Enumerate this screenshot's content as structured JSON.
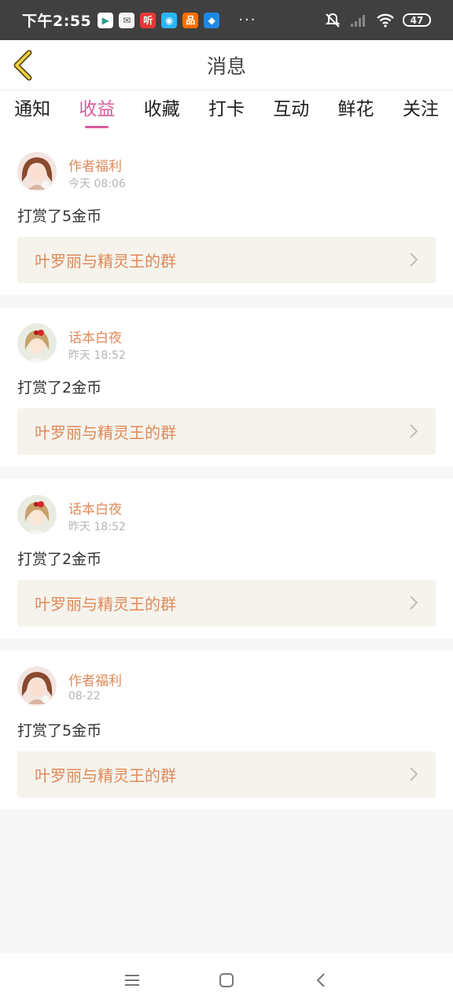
{
  "status_bar": {
    "time": "下午2:55",
    "app_icons": [
      {
        "name": "play-store-icon",
        "color": "#2a9d8f",
        "glyph": "▶"
      },
      {
        "name": "mi-app-icon",
        "color": "#f5f5f5",
        "glyph": "✉"
      },
      {
        "name": "listen-app-icon",
        "color": "#e53935",
        "glyph": "听"
      },
      {
        "name": "weibo-app-icon",
        "color": "#29b6f6",
        "glyph": "◉"
      },
      {
        "name": "shopping-app-icon",
        "color": "#ff6f00",
        "glyph": "品"
      },
      {
        "name": "blue-app-icon",
        "color": "#1e88e5",
        "glyph": "◆"
      }
    ],
    "dots": "···",
    "battery": "47"
  },
  "header": {
    "title": "消息"
  },
  "tabs": [
    {
      "label": "通知",
      "active": false
    },
    {
      "label": "收益",
      "active": true
    },
    {
      "label": "收藏",
      "active": false
    },
    {
      "label": "打卡",
      "active": false
    },
    {
      "label": "互动",
      "active": false
    },
    {
      "label": "鲜花",
      "active": false
    },
    {
      "label": "关注",
      "active": false
    }
  ],
  "messages": [
    {
      "name": "作者福利",
      "time": "今天 08:06",
      "text": "打赏了5金币",
      "link": "叶罗丽与精灵王的群",
      "avatar": "girl-brown"
    },
    {
      "name": "话本白夜",
      "time": "昨天 18:52",
      "text": "打赏了2金币",
      "link": "叶罗丽与精灵王的群",
      "avatar": "girl-bow"
    },
    {
      "name": "话本白夜",
      "time": "昨天 18:52",
      "text": "打赏了2金币",
      "link": "叶罗丽与精灵王的群",
      "avatar": "girl-bow"
    },
    {
      "name": "作者福利",
      "time": "08-22",
      "text": "打赏了5金币",
      "link": "叶罗丽与精灵王的群",
      "avatar": "girl-brown"
    }
  ],
  "colors": {
    "accent_pink": "#d85c9a",
    "name_orange": "#e08a5a",
    "link_bg": "#f5f3ec"
  }
}
